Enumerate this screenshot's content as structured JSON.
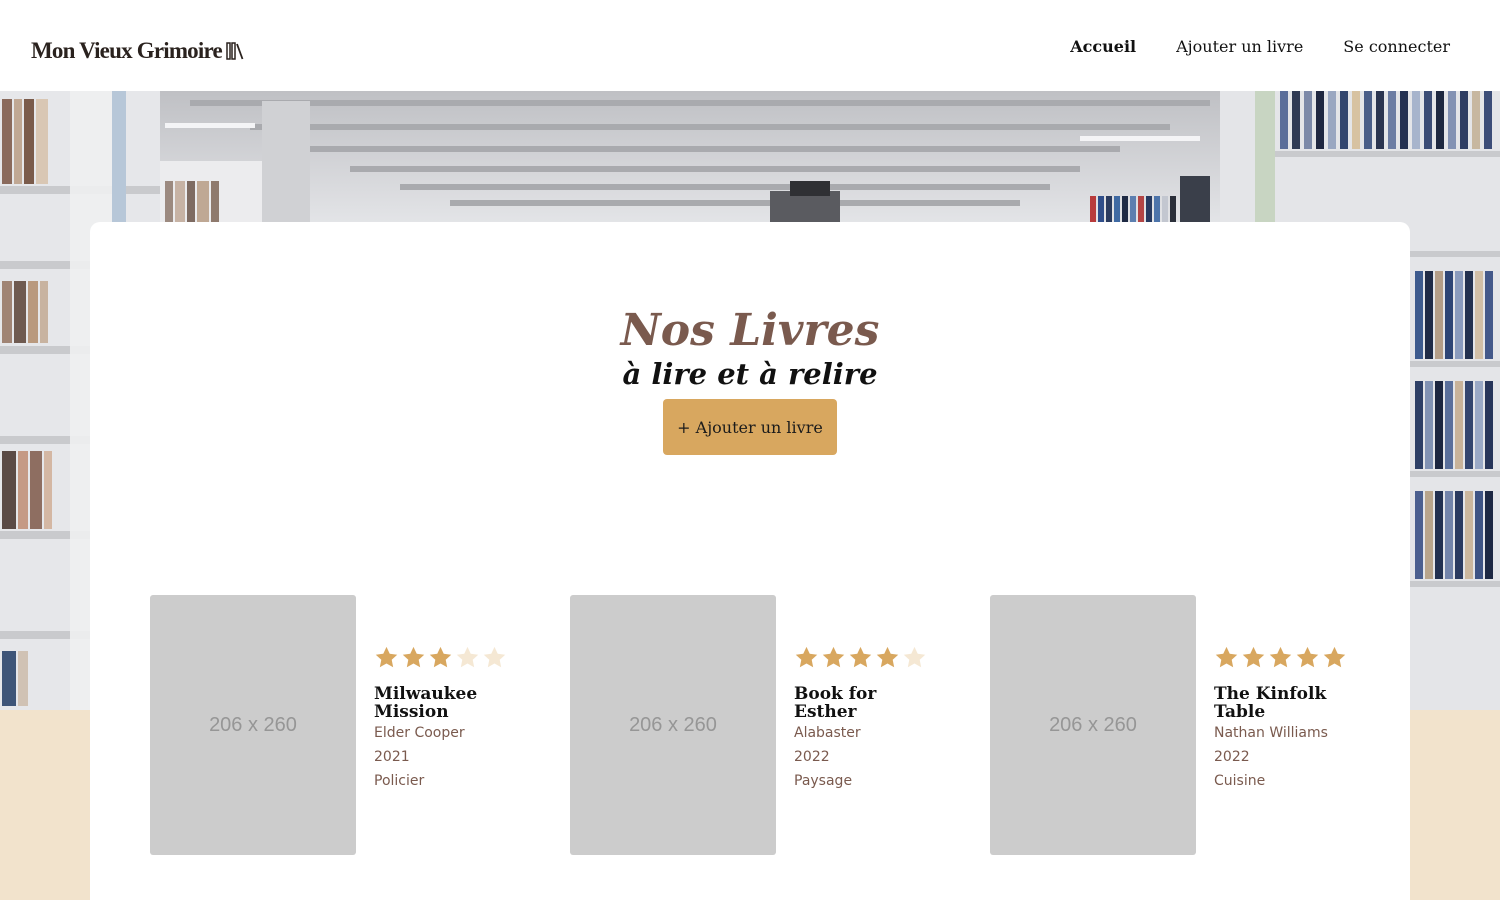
{
  "header": {
    "logo_text": "Mon Vieux Grimoire",
    "nav": [
      {
        "label": "Accueil",
        "active": true
      },
      {
        "label": "Ajouter un livre",
        "active": false
      },
      {
        "label": "Se connecter",
        "active": false
      }
    ]
  },
  "main": {
    "title": "Nos Livres",
    "subtitle": "à lire et à relire",
    "add_button_label": "+ Ajouter un livre"
  },
  "books": [
    {
      "cover_placeholder": "206 x 260",
      "rating": 3,
      "title": "Milwaukee Mission",
      "author": "Elder Cooper",
      "year": "2021",
      "genre": "Policier"
    },
    {
      "cover_placeholder": "206 x 260",
      "rating": 4,
      "title": "Book for Esther",
      "author": "Alabaster",
      "year": "2022",
      "genre": "Paysage"
    },
    {
      "cover_placeholder": "206 x 260",
      "rating": 5,
      "title": "The Kinfolk Table",
      "author": "Nathan Williams",
      "year": "2022",
      "genre": "Cuisine"
    }
  ],
  "colors": {
    "accent": "#d8a75f",
    "star_filled": "#d8a75f",
    "star_empty": "#f5e8d4",
    "title_brown": "#7a5a4e",
    "page_background": "#f2e3cc",
    "cover_placeholder": "#cccccc"
  },
  "icons": {
    "logo": "books-icon",
    "rating": "star-icon"
  }
}
